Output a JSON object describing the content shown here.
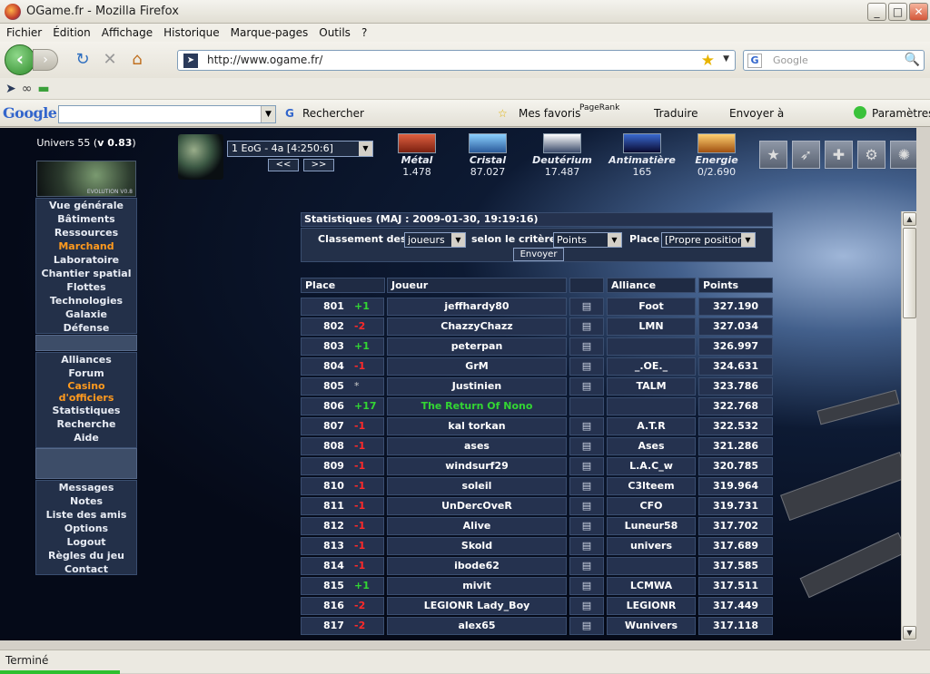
{
  "window": {
    "title": "OGame.fr - Mozilla Firefox",
    "min": "_",
    "max": "□",
    "close": "✕"
  },
  "menu": [
    "Fichier",
    "Édition",
    "Affichage",
    "Historique",
    "Marque-pages",
    "Outils",
    "?"
  ],
  "nav": {
    "url": "http://www.ogame.fr/",
    "search_placeholder": "Google"
  },
  "gtoolbar": {
    "logo": "Google",
    "rechercher": "Rechercher",
    "mes_favoris": "Mes favoris",
    "pagerank": "PageRank",
    "traduire": "Traduire",
    "envoyer": "Envoyer à",
    "parametres": "Paramètres"
  },
  "status": "Terminé",
  "game": {
    "universe_prefix": "Univers 55 (",
    "version": "v 0.83",
    "universe_suffix": ")",
    "logo_label": "EVOLUTION V0.8",
    "planet": "1 EoG - 4a [4:250:6]",
    "prev": "<<",
    "next": ">>",
    "resources": [
      {
        "name": "Métal",
        "value": "1.478",
        "color": "#c4462c"
      },
      {
        "name": "Cristal",
        "value": "87.027",
        "color": "#4a8fd0"
      },
      {
        "name": "Deutérium",
        "value": "17.487",
        "color": "#b8c4d8"
      },
      {
        "name": "Antimatière",
        "value": "165",
        "color": "#2a3a9a"
      },
      {
        "name": "Energie",
        "value": "0/2.690",
        "color": "#e0a030"
      }
    ],
    "menu1": [
      "Vue générale",
      "Bâtiments",
      "Ressources",
      "Marchand",
      "Laboratoire",
      "Chantier spatial",
      "Flottes",
      "Technologies",
      "Galaxie",
      "Défense"
    ],
    "menu1_highlight": "Marchand",
    "menu2": [
      "Alliances",
      "Forum",
      "Casino",
      "d'officiers",
      "Statistiques",
      "Recherche",
      "Aide"
    ],
    "menu3": [
      "Messages",
      "Notes",
      "Liste des amis",
      "Options",
      "Logout",
      "Règles du jeu",
      "Contact"
    ],
    "stats": {
      "header": "Statistiques (MAJ : 2009-01-30, 19:19:16)",
      "classement_label": "Classement des",
      "classement_value": "joueurs",
      "critere_label": "selon le critère",
      "critere_value": "Points",
      "place_label": "Place",
      "place_value": "[Propre position]",
      "submit": "Envoyer",
      "columns": [
        "Place",
        "Joueur",
        "",
        "Alliance",
        "Points"
      ],
      "rows": [
        {
          "place": "801",
          "delta": "+1",
          "trend": "up",
          "player": "jeffhardy80",
          "alliance": "Foot",
          "points": "327.190"
        },
        {
          "place": "802",
          "delta": "-2",
          "trend": "dn",
          "player": "ChazzyChazz",
          "alliance": "LMN",
          "points": "327.034"
        },
        {
          "place": "803",
          "delta": "+1",
          "trend": "up",
          "player": "peterpan",
          "alliance": "",
          "points": "326.997"
        },
        {
          "place": "804",
          "delta": "-1",
          "trend": "dn",
          "player": "GrM",
          "alliance": "_.OE._",
          "points": "324.631"
        },
        {
          "place": "805",
          "delta": "*",
          "trend": "eq",
          "player": "Justinien",
          "alliance": "TALM",
          "points": "323.786"
        },
        {
          "place": "806",
          "delta": "+17",
          "trend": "up",
          "player": "The Return Of Nono",
          "alliance": "",
          "points": "322.768",
          "self": true
        },
        {
          "place": "807",
          "delta": "-1",
          "trend": "dn",
          "player": "kal torkan",
          "alliance": "A.T.R",
          "points": "322.532"
        },
        {
          "place": "808",
          "delta": "-1",
          "trend": "dn",
          "player": "ases",
          "alliance": "Ases",
          "points": "321.286"
        },
        {
          "place": "809",
          "delta": "-1",
          "trend": "dn",
          "player": "windsurf29",
          "alliance": "L.A.C_w",
          "points": "320.785"
        },
        {
          "place": "810",
          "delta": "-1",
          "trend": "dn",
          "player": "soleil",
          "alliance": "C3lteem",
          "points": "319.964"
        },
        {
          "place": "811",
          "delta": "-1",
          "trend": "dn",
          "player": "UnDercOveR",
          "alliance": "CFO",
          "points": "319.731"
        },
        {
          "place": "812",
          "delta": "-1",
          "trend": "dn",
          "player": "Alive",
          "alliance": "Luneur58",
          "points": "317.702"
        },
        {
          "place": "813",
          "delta": "-1",
          "trend": "dn",
          "player": "Skold",
          "alliance": "univers",
          "points": "317.689"
        },
        {
          "place": "814",
          "delta": "-1",
          "trend": "dn",
          "player": "ibode62",
          "alliance": "",
          "points": "317.585"
        },
        {
          "place": "815",
          "delta": "+1",
          "trend": "up",
          "player": "mivit",
          "alliance": "LCMWA",
          "points": "317.511"
        },
        {
          "place": "816",
          "delta": "-2",
          "trend": "dn",
          "player": "LEGIONR Lady_Boy",
          "alliance": "LEGIONR",
          "points": "317.449"
        },
        {
          "place": "817",
          "delta": "-2",
          "trend": "dn",
          "player": "alex65",
          "alliance": "Wunivers",
          "points": "317.118"
        }
      ]
    }
  }
}
